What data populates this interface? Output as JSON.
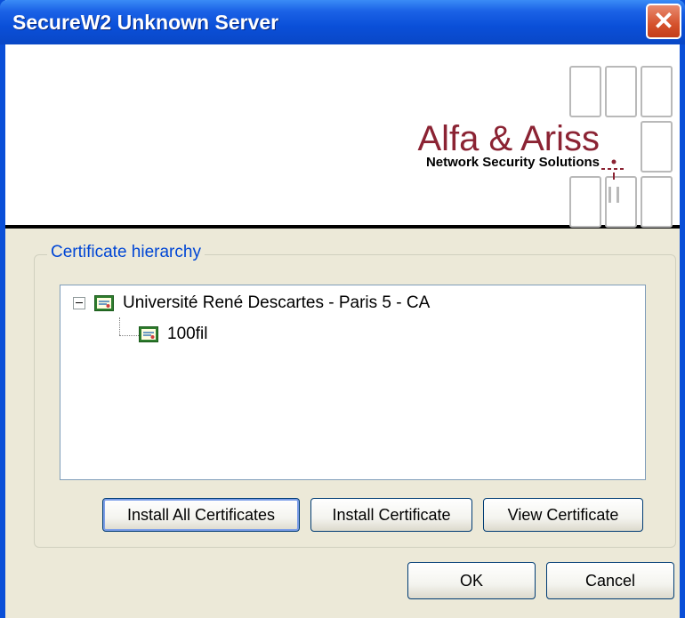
{
  "window": {
    "title": "SecureW2 Unknown Server",
    "close_label": "✕"
  },
  "banner": {
    "logo_text": "Alfa & Ariss",
    "logo_subtitle": "Network Security Solutions"
  },
  "certificate_group": {
    "label": "Certificate hierarchy",
    "tree": [
      {
        "label": "Université René Descartes - Paris 5 - CA",
        "expanded": true,
        "icon": "certificate-icon"
      },
      {
        "label": "100fil",
        "icon": "certificate-icon"
      }
    ]
  },
  "buttons": {
    "install_all": "Install All Certificates",
    "install": "Install Certificate",
    "view": "View Certificate",
    "ok": "OK",
    "cancel": "Cancel"
  },
  "colors": {
    "titlebar": "#0a4fd8",
    "logo_red": "#8b2333",
    "group_label": "#0046d5",
    "dialog_bg": "#ece9d8"
  }
}
